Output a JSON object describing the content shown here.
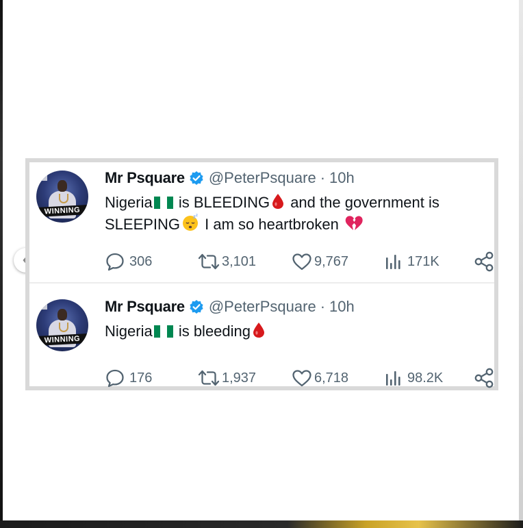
{
  "tweets": [
    {
      "name": "Mr Psquare",
      "handle": "@PeterPsquare",
      "separator": "·",
      "time": "10h",
      "avatar_badge": "WINNING",
      "text_segments": [
        "Nigeria",
        " is BLEEDING",
        "  and the government is SLEEPING",
        " I am so heartbroken "
      ],
      "replies": "306",
      "retweets": "3,101",
      "likes": "9,767",
      "views": "171K"
    },
    {
      "name": "Mr Psquare",
      "handle": "@PeterPsquare",
      "separator": "·",
      "time": "10h",
      "avatar_badge": "WINNING",
      "text_segments": [
        "Nigeria",
        " is bleeding"
      ],
      "replies": "176",
      "retweets": "1,937",
      "likes": "6,718",
      "views": "98.2K"
    }
  ],
  "icons": {
    "verified": "verified-badge-icon",
    "flag": "nigeria-flag-icon",
    "blood": "blood-drop-icon",
    "sleepy": "sleepy-face-icon",
    "broken_heart": "broken-heart-icon",
    "reply": "reply-icon",
    "retweet": "retweet-icon",
    "like": "heart-icon",
    "views": "views-icon",
    "share": "share-icon",
    "prev": "chevron-left-icon"
  },
  "colors": {
    "text": "#0f1419",
    "muted": "#536471",
    "verified": "#1d9bf0",
    "flag_green": "#008751",
    "blood": "#d7191c",
    "card_border": "#d9d9d9"
  }
}
